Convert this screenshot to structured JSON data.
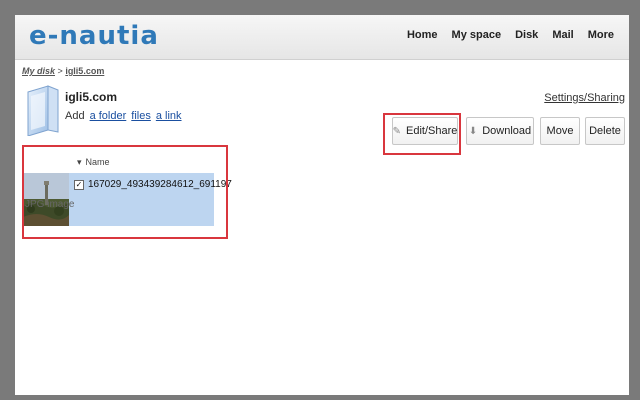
{
  "header": {
    "logo": "e-nautia",
    "nav": [
      "Home",
      "My space",
      "Disk",
      "Mail",
      "More"
    ]
  },
  "breadcrumb": {
    "root": "My disk",
    "separator": ">",
    "current": "igli5.com"
  },
  "folder": {
    "title": "igli5.com",
    "add_label": "Add",
    "add_folder": "a folder",
    "add_files": "files",
    "add_link": "a link"
  },
  "settings_link": "Settings/Sharing",
  "toolbar": {
    "edit_share": "Edit/Share",
    "download": "Download",
    "move": "Move",
    "delete": "Delete"
  },
  "list": {
    "sort_column": "Name",
    "files": [
      {
        "name": "167029_493439284612_691197",
        "type": "JPG image",
        "checked": true
      }
    ]
  },
  "colors": {
    "brand": "#2f79b8",
    "selection": "#bdd5f0",
    "highlight": "#d9363e"
  }
}
